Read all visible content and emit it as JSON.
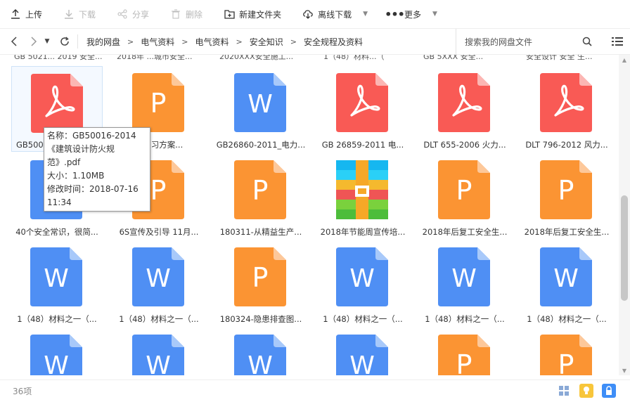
{
  "toolbar": {
    "upload": "上传",
    "download": "下载",
    "share": "分享",
    "delete": "删除",
    "new_folder": "新建文件夹",
    "offline_download": "离线下载",
    "more": "更多"
  },
  "breadcrumb": [
    "我的网盘",
    "电气资料",
    "电气资料",
    "安全知识",
    "安全规程及资料"
  ],
  "search": {
    "placeholder": "搜索我的网盘文件"
  },
  "partial_row": [
    "GB 5021... 2019 安全...",
    "2018年 ...城市安全...",
    "2020XXX安全施工...",
    "1（48）材料...（",
    "GB 5XXX 安全...",
    "安全设计 安全 生..."
  ],
  "files": [
    {
      "name": "GB50016-2014《建筑设计防火规范》.pdf",
      "type": "pdf"
    },
    {
      "name": "防演习方案...",
      "type": "ppt"
    },
    {
      "name": "GB26860-2011_电力...",
      "type": "word"
    },
    {
      "name": "GB 26859-2011 电...",
      "type": "pdf"
    },
    {
      "name": "DLT 655-2006 火力...",
      "type": "pdf"
    },
    {
      "name": "DLT 796-2012 风力...",
      "type": "pdf"
    },
    {
      "name": "40个安全常识，很简...",
      "type": "word"
    },
    {
      "name": "6S宣传及引导  11月...",
      "type": "ppt"
    },
    {
      "name": "180311-从精益生产...",
      "type": "ppt"
    },
    {
      "name": "2018年节能周宣传培...",
      "type": "zip"
    },
    {
      "name": "2018年后复工安全生...",
      "type": "ppt"
    },
    {
      "name": "2018年后复工安全生...",
      "type": "ppt"
    },
    {
      "name": "1（48）材料之一（...",
      "type": "word"
    },
    {
      "name": "1（48）材料之一（...",
      "type": "word"
    },
    {
      "name": "180324-隐患排查图...",
      "type": "ppt"
    },
    {
      "name": "1（48）材料之一（...",
      "type": "word"
    },
    {
      "name": "1（48）材料之一（...",
      "type": "word"
    },
    {
      "name": "1（48）材料之一（...",
      "type": "word"
    },
    {
      "name": "",
      "type": "word"
    },
    {
      "name": "",
      "type": "word"
    },
    {
      "name": "",
      "type": "word"
    },
    {
      "name": "",
      "type": "word"
    },
    {
      "name": "",
      "type": "ppt"
    },
    {
      "name": "",
      "type": "ppt"
    }
  ],
  "first_item_label": "GB500",
  "tooltip": {
    "name": "名称：GB50016-2014《建筑设计防火规范》.pdf",
    "size": "大小：1.10MB",
    "modified": "修改时间：2018-07-16 11:34"
  },
  "status": {
    "count": "36项"
  },
  "colors": {
    "pdf": "#f95a55",
    "ppt": "#fb9433",
    "word": "#4f8ff4",
    "fold_pdf": "#fcb6b3",
    "fold_ppt": "#fdc89a",
    "fold_word": "#a8c9fa"
  }
}
